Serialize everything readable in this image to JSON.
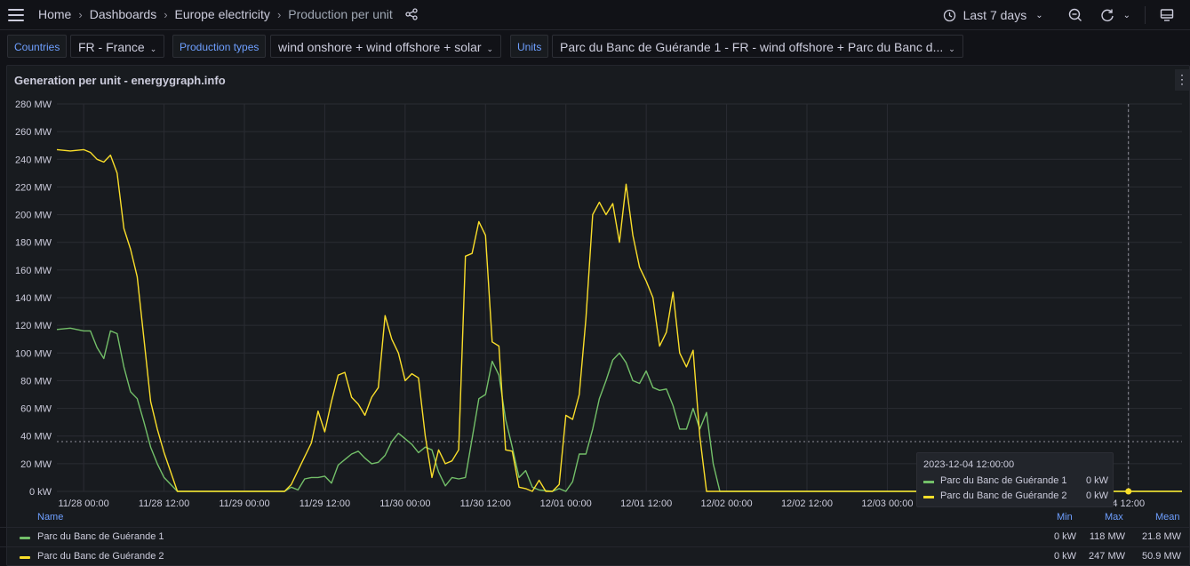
{
  "topbar": {
    "breadcrumb": [
      "Home",
      "Dashboards",
      "Europe electricity"
    ],
    "current": "Production per unit",
    "time_range": "Last 7 days"
  },
  "variables": {
    "countries_label": "Countries",
    "countries_value": "FR - France",
    "types_label": "Production types",
    "types_value": "wind onshore + wind offshore + solar",
    "units_label": "Units",
    "units_value": "Parc du Banc de Guérande 1 - FR - wind offshore + Parc du Banc d..."
  },
  "panel": {
    "title": "Generation per unit - energygraph.info",
    "menu_glyph": "⋮"
  },
  "legend": {
    "name_header": "Name",
    "min_header": "Min",
    "max_header": "Max",
    "mean_header": "Mean",
    "rows": [
      {
        "name": "Parc du Banc de Guérande 1",
        "min": "0 kW",
        "max": "118 MW",
        "mean": "21.8 MW"
      },
      {
        "name": "Parc du Banc de Guérande 2",
        "min": "0 kW",
        "max": "247 MW",
        "mean": "50.9 MW"
      }
    ]
  },
  "tooltip": {
    "time": "2023-12-04 12:00:00",
    "rows": [
      {
        "name": "Parc du Banc de Guérande 1",
        "value": "0 kW"
      },
      {
        "name": "Parc du Banc de Guérande 2",
        "value": "0 kW"
      }
    ]
  },
  "colors": {
    "series1": "#73bf69",
    "series2": "#fade2a",
    "accent": "#6e9fff"
  },
  "icons": {
    "menu": "hamburger-icon",
    "share": "share-icon",
    "clock": "clock-icon",
    "zoom_out": "zoom-out-icon",
    "refresh": "refresh-icon",
    "tv": "tv-mode-icon"
  },
  "chart_data": {
    "type": "line",
    "xlabel": "",
    "ylabel": "",
    "ylim": [
      0,
      280
    ],
    "y_unit": "MW",
    "yticks": [
      0,
      20,
      40,
      60,
      80,
      100,
      120,
      140,
      160,
      180,
      200,
      220,
      240,
      260,
      280
    ],
    "ytick_labels": [
      "0 kW",
      "20 MW",
      "40 MW",
      "60 MW",
      "80 MW",
      "100 MW",
      "120 MW",
      "140 MW",
      "160 MW",
      "180 MW",
      "200 MW",
      "220 MW",
      "240 MW",
      "260 MW",
      "280 MW"
    ],
    "xlim": [
      "2023-11-27 20:00",
      "2023-12-04 20:00"
    ],
    "xticks": [
      "2023-11-28 00:00",
      "2023-11-28 12:00",
      "2023-11-29 00:00",
      "2023-11-29 12:00",
      "2023-11-30 00:00",
      "2023-11-30 12:00",
      "2023-12-01 00:00",
      "2023-12-01 12:00",
      "2023-12-02 00:00",
      "2023-12-02 12:00",
      "2023-12-03 00:00",
      "2023-12-04 12:00"
    ],
    "xtick_labels": [
      "11/28 00:00",
      "11/28 12:00",
      "11/29 00:00",
      "11/29 12:00",
      "11/30 00:00",
      "11/30 12:00",
      "12/01 00:00",
      "12/01 12:00",
      "12/02 00:00",
      "12/02 12:00",
      "12/03 00:00",
      "4 12:00"
    ],
    "cursor_x": "2023-12-04 12:00",
    "threshold_y": 36,
    "series": [
      {
        "name": "Parc du Banc de Guérande 1",
        "color": "#73bf69",
        "points": [
          [
            "2023-11-27 20:00",
            117
          ],
          [
            "2023-11-27 22:00",
            118
          ],
          [
            "2023-11-28 00:00",
            116
          ],
          [
            "2023-11-28 01:00",
            116
          ],
          [
            "2023-11-28 02:00",
            104
          ],
          [
            "2023-11-28 03:00",
            96
          ],
          [
            "2023-11-28 04:00",
            116
          ],
          [
            "2023-11-28 05:00",
            114
          ],
          [
            "2023-11-28 06:00",
            90
          ],
          [
            "2023-11-28 07:00",
            72
          ],
          [
            "2023-11-28 08:00",
            67
          ],
          [
            "2023-11-28 09:00",
            50
          ],
          [
            "2023-11-28 10:00",
            32
          ],
          [
            "2023-11-28 11:00",
            20
          ],
          [
            "2023-11-28 12:00",
            10
          ],
          [
            "2023-11-28 14:00",
            0
          ],
          [
            "2023-11-29 06:00",
            0
          ],
          [
            "2023-11-29 07:00",
            3
          ],
          [
            "2023-11-29 08:00",
            1
          ],
          [
            "2023-11-29 09:00",
            9
          ],
          [
            "2023-11-29 10:00",
            10
          ],
          [
            "2023-11-29 11:00",
            10
          ],
          [
            "2023-11-29 12:00",
            11
          ],
          [
            "2023-11-29 13:00",
            6
          ],
          [
            "2023-11-29 14:00",
            19
          ],
          [
            "2023-11-29 15:00",
            23
          ],
          [
            "2023-11-29 16:00",
            27
          ],
          [
            "2023-11-29 17:00",
            29
          ],
          [
            "2023-11-29 18:00",
            24
          ],
          [
            "2023-11-29 19:00",
            20
          ],
          [
            "2023-11-29 20:00",
            21
          ],
          [
            "2023-11-29 21:00",
            26
          ],
          [
            "2023-11-29 22:00",
            36
          ],
          [
            "2023-11-29 23:00",
            42
          ],
          [
            "2023-11-30 00:00",
            38
          ],
          [
            "2023-11-30 01:00",
            34
          ],
          [
            "2023-11-30 02:00",
            28
          ],
          [
            "2023-11-30 03:00",
            32
          ],
          [
            "2023-11-30 04:00",
            30
          ],
          [
            "2023-11-30 05:00",
            14
          ],
          [
            "2023-11-30 06:00",
            4
          ],
          [
            "2023-11-30 07:00",
            10
          ],
          [
            "2023-11-30 08:00",
            9
          ],
          [
            "2023-11-30 09:00",
            10
          ],
          [
            "2023-11-30 10:00",
            38
          ],
          [
            "2023-11-30 11:00",
            67
          ],
          [
            "2023-11-30 12:00",
            70
          ],
          [
            "2023-11-30 13:00",
            94
          ],
          [
            "2023-11-30 14:00",
            84
          ],
          [
            "2023-11-30 15:00",
            52
          ],
          [
            "2023-11-30 16:00",
            32
          ],
          [
            "2023-11-30 17:00",
            10
          ],
          [
            "2023-11-30 18:00",
            15
          ],
          [
            "2023-11-30 19:00",
            3
          ],
          [
            "2023-11-30 20:00",
            1
          ],
          [
            "2023-11-30 22:00",
            0
          ],
          [
            "2023-11-30 23:00",
            2
          ],
          [
            "2023-12-01 00:00",
            0
          ],
          [
            "2023-12-01 01:00",
            7
          ],
          [
            "2023-12-01 02:00",
            27
          ],
          [
            "2023-12-01 03:00",
            27
          ],
          [
            "2023-12-01 04:00",
            45
          ],
          [
            "2023-12-01 05:00",
            67
          ],
          [
            "2023-12-01 06:00",
            80
          ],
          [
            "2023-12-01 07:00",
            95
          ],
          [
            "2023-12-01 08:00",
            100
          ],
          [
            "2023-12-01 09:00",
            93
          ],
          [
            "2023-12-01 10:00",
            80
          ],
          [
            "2023-12-01 11:00",
            78
          ],
          [
            "2023-12-01 12:00",
            87
          ],
          [
            "2023-12-01 13:00",
            75
          ],
          [
            "2023-12-01 14:00",
            73
          ],
          [
            "2023-12-01 15:00",
            74
          ],
          [
            "2023-12-01 16:00",
            62
          ],
          [
            "2023-12-01 17:00",
            45
          ],
          [
            "2023-12-01 18:00",
            45
          ],
          [
            "2023-12-01 19:00",
            60
          ],
          [
            "2023-12-01 20:00",
            45
          ],
          [
            "2023-12-01 21:00",
            57
          ],
          [
            "2023-12-01 22:00",
            20
          ],
          [
            "2023-12-01 23:00",
            0
          ],
          [
            "2023-12-04 20:00",
            0
          ]
        ]
      },
      {
        "name": "Parc du Banc de Guérande 2",
        "color": "#fade2a",
        "points": [
          [
            "2023-11-27 20:00",
            247
          ],
          [
            "2023-11-27 22:00",
            246
          ],
          [
            "2023-11-28 00:00",
            247
          ],
          [
            "2023-11-28 01:00",
            245
          ],
          [
            "2023-11-28 02:00",
            240
          ],
          [
            "2023-11-28 03:00",
            238
          ],
          [
            "2023-11-28 04:00",
            243
          ],
          [
            "2023-11-28 05:00",
            230
          ],
          [
            "2023-11-28 06:00",
            190
          ],
          [
            "2023-11-28 07:00",
            175
          ],
          [
            "2023-11-28 08:00",
            155
          ],
          [
            "2023-11-28 09:00",
            110
          ],
          [
            "2023-11-28 10:00",
            65
          ],
          [
            "2023-11-28 11:00",
            45
          ],
          [
            "2023-11-28 12:00",
            28
          ],
          [
            "2023-11-28 14:00",
            0
          ],
          [
            "2023-11-29 06:00",
            0
          ],
          [
            "2023-11-29 07:00",
            5
          ],
          [
            "2023-11-29 08:00",
            15
          ],
          [
            "2023-11-29 09:00",
            25
          ],
          [
            "2023-11-29 10:00",
            35
          ],
          [
            "2023-11-29 11:00",
            58
          ],
          [
            "2023-11-29 12:00",
            43
          ],
          [
            "2023-11-29 13:00",
            65
          ],
          [
            "2023-11-29 14:00",
            84
          ],
          [
            "2023-11-29 15:00",
            86
          ],
          [
            "2023-11-29 16:00",
            68
          ],
          [
            "2023-11-29 17:00",
            63
          ],
          [
            "2023-11-29 18:00",
            55
          ],
          [
            "2023-11-29 19:00",
            68
          ],
          [
            "2023-11-29 20:00",
            75
          ],
          [
            "2023-11-29 21:00",
            127
          ],
          [
            "2023-11-29 22:00",
            110
          ],
          [
            "2023-11-29 23:00",
            100
          ],
          [
            "2023-11-30 00:00",
            80
          ],
          [
            "2023-11-30 01:00",
            85
          ],
          [
            "2023-11-30 02:00",
            82
          ],
          [
            "2023-11-30 03:00",
            40
          ],
          [
            "2023-11-30 04:00",
            10
          ],
          [
            "2023-11-30 05:00",
            30
          ],
          [
            "2023-11-30 06:00",
            20
          ],
          [
            "2023-11-30 07:00",
            22
          ],
          [
            "2023-11-30 08:00",
            30
          ],
          [
            "2023-11-30 09:00",
            170
          ],
          [
            "2023-11-30 10:00",
            172
          ],
          [
            "2023-11-30 11:00",
            195
          ],
          [
            "2023-11-30 12:00",
            185
          ],
          [
            "2023-11-30 13:00",
            108
          ],
          [
            "2023-11-30 14:00",
            105
          ],
          [
            "2023-11-30 15:00",
            30
          ],
          [
            "2023-11-30 16:00",
            29
          ],
          [
            "2023-11-30 17:00",
            3
          ],
          [
            "2023-11-30 18:00",
            2
          ],
          [
            "2023-11-30 19:00",
            0
          ],
          [
            "2023-11-30 20:00",
            8
          ],
          [
            "2023-11-30 21:00",
            0
          ],
          [
            "2023-11-30 22:00",
            0
          ],
          [
            "2023-11-30 23:00",
            5
          ],
          [
            "2023-12-01 00:00",
            55
          ],
          [
            "2023-12-01 01:00",
            52
          ],
          [
            "2023-12-01 02:00",
            70
          ],
          [
            "2023-12-01 03:00",
            125
          ],
          [
            "2023-12-01 04:00",
            200
          ],
          [
            "2023-12-01 05:00",
            209
          ],
          [
            "2023-12-01 06:00",
            200
          ],
          [
            "2023-12-01 07:00",
            208
          ],
          [
            "2023-12-01 08:00",
            180
          ],
          [
            "2023-12-01 09:00",
            222
          ],
          [
            "2023-12-01 10:00",
            185
          ],
          [
            "2023-12-01 11:00",
            162
          ],
          [
            "2023-12-01 12:00",
            152
          ],
          [
            "2023-12-01 13:00",
            140
          ],
          [
            "2023-12-01 14:00",
            105
          ],
          [
            "2023-12-01 15:00",
            115
          ],
          [
            "2023-12-01 16:00",
            144
          ],
          [
            "2023-12-01 17:00",
            100
          ],
          [
            "2023-12-01 18:00",
            90
          ],
          [
            "2023-12-01 19:00",
            102
          ],
          [
            "2023-12-01 20:00",
            40
          ],
          [
            "2023-12-01 21:00",
            0
          ],
          [
            "2023-12-04 20:00",
            0
          ]
        ]
      }
    ]
  }
}
